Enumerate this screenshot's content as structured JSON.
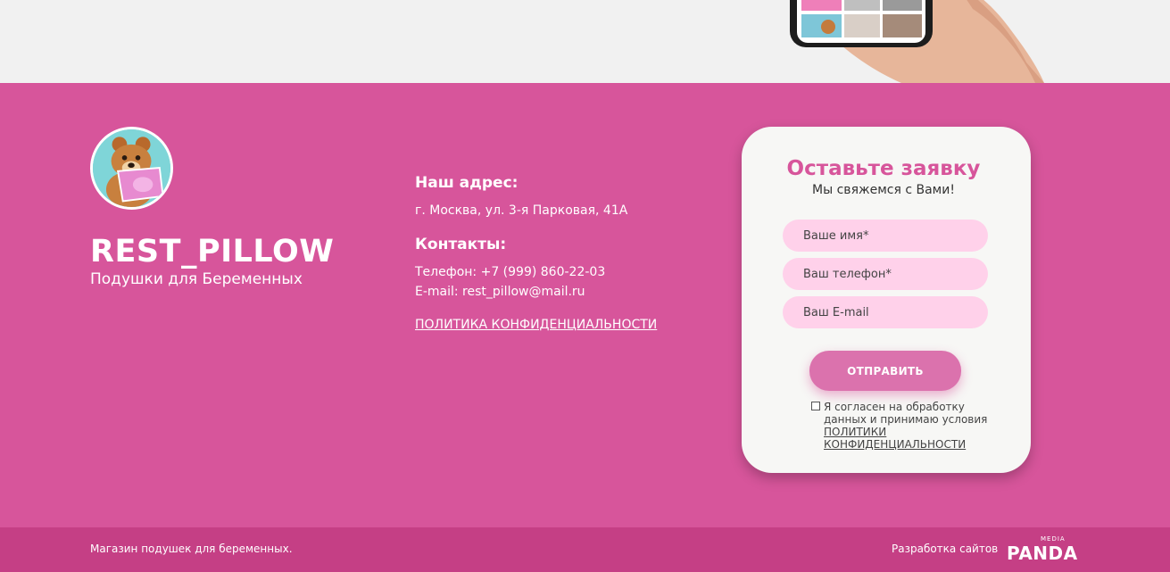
{
  "brand": {
    "title": "REST_PILLOW",
    "subtitle": "Подушки для Беременных"
  },
  "contacts": {
    "address_heading": "Наш адрес:",
    "address": "г. Москва, ул. 3-я Парковая, 41А",
    "contacts_heading": "Контакты:",
    "phone": "Телефон: +7 (999) 860-22-03",
    "email": "E-mail: rest_pillow@mail.ru",
    "policy_link": "ПОЛИТИКА КОНФИДЕНЦИАЛЬНОСТИ"
  },
  "form": {
    "title": "Оставьте заявку",
    "subtitle": "Мы свяжемся с Вами!",
    "name_placeholder": "Ваше имя*",
    "phone_placeholder": "Ваш телефон*",
    "email_placeholder": "Ваш E-mail",
    "submit_label": "ОТПРАВИТЬ",
    "consent_line1": "Я согласен на обработку",
    "consent_line2": "данных и принимаю условия",
    "consent_link": "ПОЛИТИКИ КОНФИДЕНЦИАЛЬНОСТИ"
  },
  "footer": {
    "left_text": "Магазин подушек для беременных.",
    "right_text": "Разработка сайтов",
    "dev_logo_small": "MEDIA",
    "dev_logo_word": "PANDA"
  },
  "colors": {
    "footer_pink": "#d7559b",
    "footer_bottom": "#c53f85",
    "input_pink": "#ffd1ea",
    "button_pink": "#db72ad"
  },
  "icons": {
    "logo": "teddy-bear-pillow-logo",
    "hand_phone": "hand-holding-phone-image",
    "checkbox": "consent-checkbox"
  }
}
